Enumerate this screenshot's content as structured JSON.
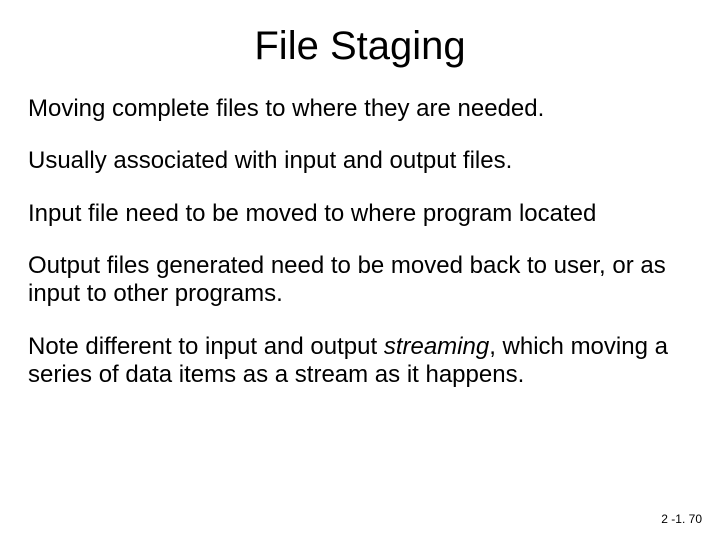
{
  "title": "File Staging",
  "paragraphs": {
    "p1": "Moving complete files to where they are needed.",
    "p2": "Usually associated with input and output files.",
    "p3": "Input file need to be moved to where program located",
    "p4": "Output files generated need to be moved back to user, or as input to other programs.",
    "p5a": "Note different to input and output ",
    "p5b_italic": "streaming",
    "p5c": ", which moving a series of data items as a stream as it happens."
  },
  "footer": "2 -1. 70"
}
